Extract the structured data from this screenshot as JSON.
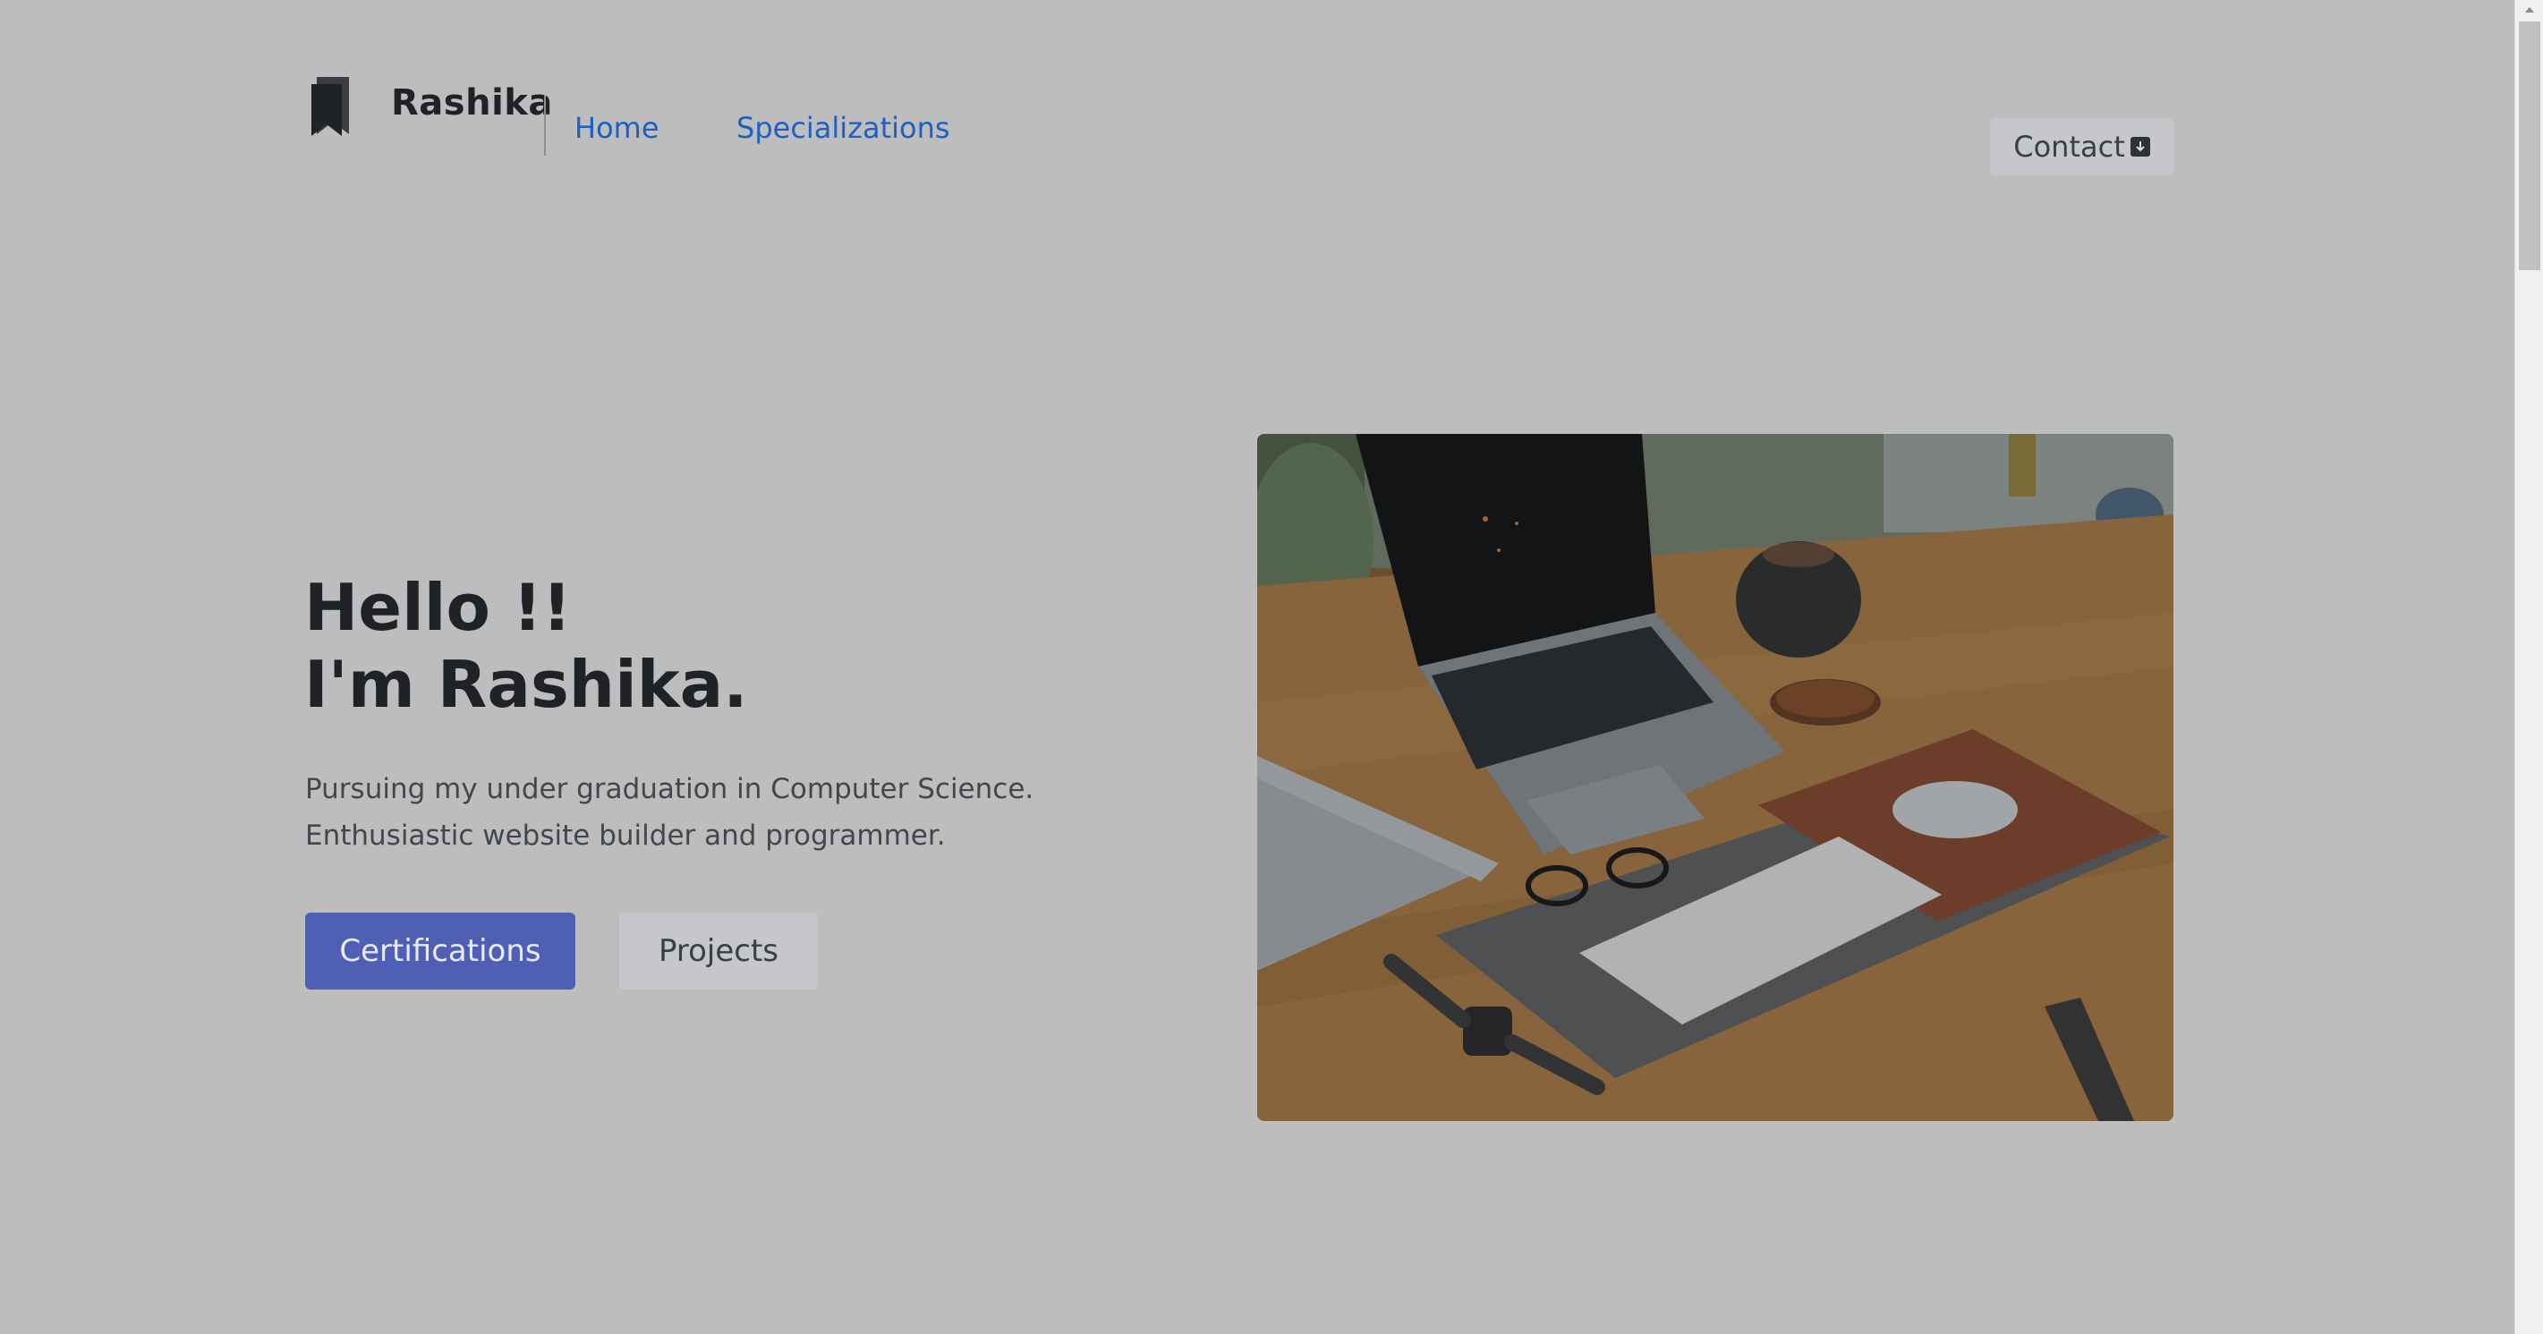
{
  "header": {
    "brand": "Rashika",
    "nav": [
      {
        "label": "Home"
      },
      {
        "label": "Specializations"
      }
    ],
    "contact_label": "Contact"
  },
  "hero": {
    "title_line1": "Hello !!",
    "title_line2": "I'm Rashika.",
    "desc_line1": "Pursuing my under graduation in Computer Science.",
    "desc_line2": "Enthusiastic website builder and programmer.",
    "primary_button": "Certifications",
    "secondary_button": "Projects"
  },
  "colors": {
    "page_bg": "#bdbdbd",
    "link": "#1f5fbf",
    "primary": "#4f5fb4",
    "secondary": "#c5c7cb",
    "heading": "#1f2328"
  },
  "icons": {
    "logo": "bookmarks-icon",
    "contact": "arrow-down-square-icon"
  }
}
